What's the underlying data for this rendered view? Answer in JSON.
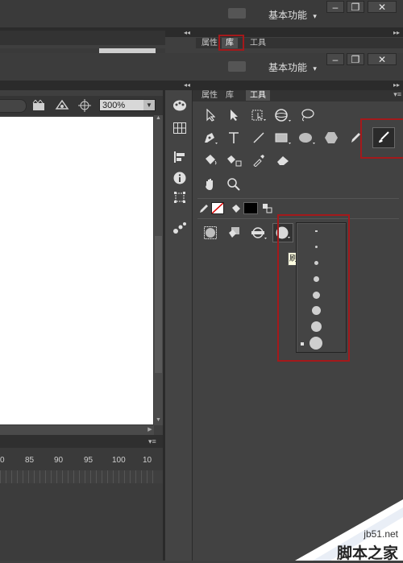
{
  "workspace": {
    "label": "基本功能",
    "dropdown_glyph": "▾"
  },
  "window": {
    "minimize": "–",
    "restore": "❐",
    "close": "✕"
  },
  "panel_tabs": [
    {
      "label": "属性"
    },
    {
      "label": "库"
    },
    {
      "label": "工具"
    }
  ],
  "toolbar": {
    "zoom_value": "300%"
  },
  "brush_popup": {
    "tooltip_char": "刷",
    "sizes": [
      2,
      3,
      5,
      7,
      9,
      11,
      13,
      16
    ]
  },
  "timeline": {
    "ruler_labels": [
      "0",
      "85",
      "90",
      "95",
      "100",
      "10"
    ]
  },
  "watermark": {
    "domain": "jb51.net",
    "name": "脚本之家"
  },
  "colors": {
    "highlight": "#a4191b",
    "accent_white": "#ffffff"
  }
}
